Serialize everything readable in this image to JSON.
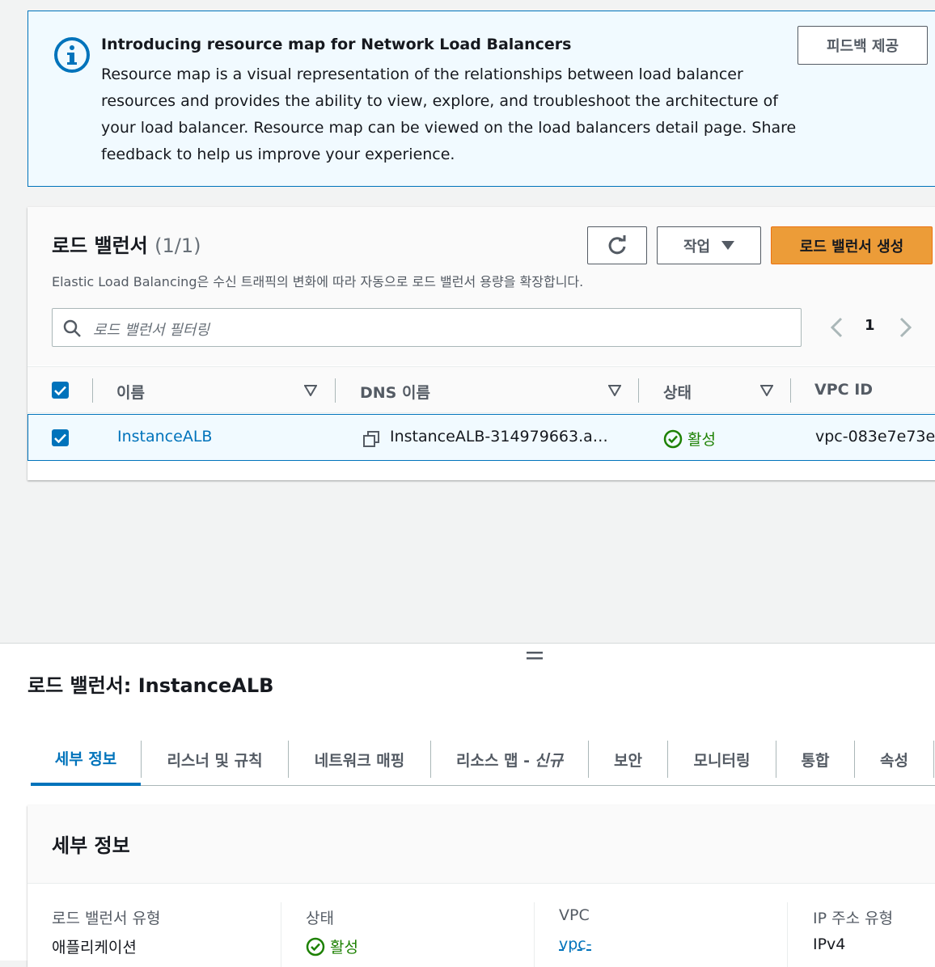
{
  "banner": {
    "title": "Introducing resource map for Network Load Balancers",
    "body": "Resource map is a visual representation of the relationships between load balancer resources and provides the ability to view, explore, and troubleshoot the architecture of your load balancer. Resource map can be viewed on the load balancers detail page. Share feedback to help us improve your experience.",
    "feedback_button": "피드백 제공"
  },
  "lb": {
    "title": "로드 밸런서",
    "count": "(1/1)",
    "description": "Elastic Load Balancing은 수신 트래픽의 변화에 따라 자동으로 로드 밸런서 용량을 확장합니다.",
    "actions_button": "작업",
    "create_button": "로드 밸런서 생성",
    "search_placeholder": "로드 밸런서 필터링",
    "page": "1",
    "columns": [
      "이름",
      "DNS 이름",
      "상태",
      "VPC ID"
    ],
    "row": {
      "name": "InstanceALB",
      "dns": "InstanceALB-314979663.a…",
      "status": "활성",
      "vpc": "vpc-083e7e73e"
    }
  },
  "detail": {
    "title": "로드 밸런서: InstanceALB",
    "tabs": [
      "세부 정보",
      "리스너 및 규칙",
      "네트워크 매핑",
      "리소스 맵 -",
      "신규",
      "보안",
      "모니터링",
      "통합",
      "속성"
    ],
    "section_title": "세부 정보",
    "fields": [
      {
        "label": "로드 밸런서 유형",
        "value": "애플리케이션"
      },
      {
        "label": "상태",
        "value": "활성"
      },
      {
        "label": "VPC",
        "value": "vpc-"
      },
      {
        "label": "IP 주소 유형",
        "value": "IPv4"
      }
    ]
  },
  "colors": {
    "accent": "#0073bb",
    "primary_button": "#ec9c38",
    "success": "#1d8102",
    "banner_bg": "#f1faff"
  }
}
